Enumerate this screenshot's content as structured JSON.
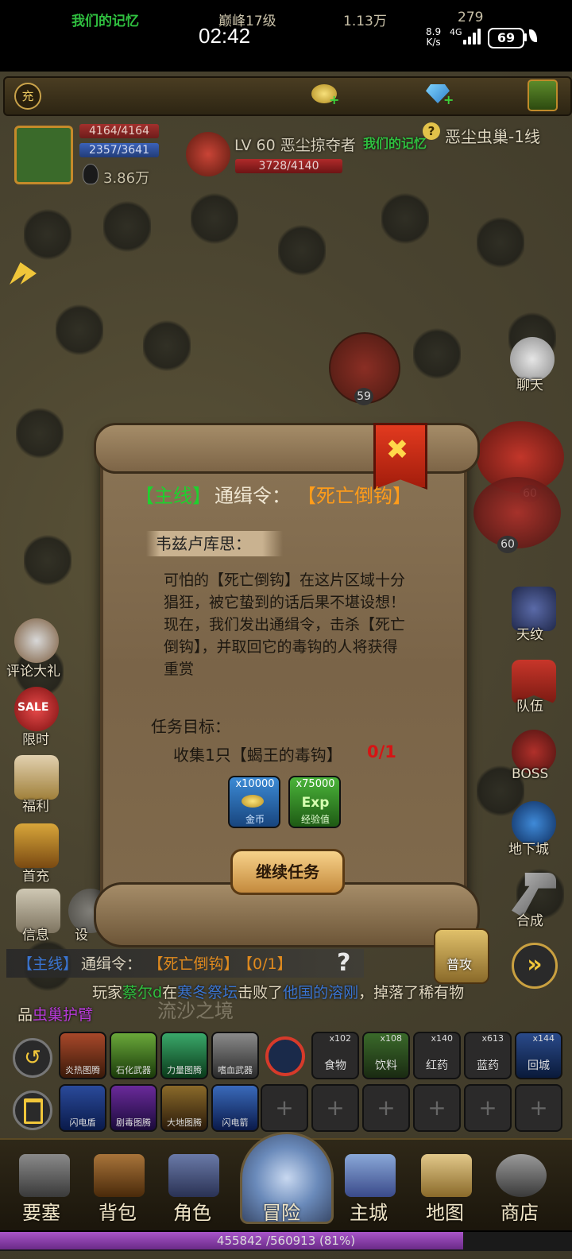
{
  "status_bar": {
    "time": "02:42",
    "net_speed_value": "8.9",
    "net_speed_unit": "K/s",
    "network": "4G",
    "battery": "69"
  },
  "top_bar": {
    "guild_badge": "充",
    "guild_name": "我们的记忆",
    "peak_level": "巅峰17级",
    "gold": "1.13万",
    "diamonds": "279",
    "gold_color": "#e6c84a",
    "guild_color": "#2fbf3f"
  },
  "player": {
    "hp": "4164/4164",
    "mp": "2357/3641",
    "power": "3.86万"
  },
  "target": {
    "name": "LV 60 恶尘掠夺者",
    "guild": "我们的记忆",
    "hp": "3728/4140",
    "map_name": "恶尘虫巢-1线"
  },
  "monsters": {
    "level_59": "59",
    "level_60a": "60",
    "level_60b": "60"
  },
  "dialog": {
    "tag": "【主线】",
    "title_prefix": "通缉令：",
    "title_target": "【死亡倒钩】",
    "speaker": "韦兹卢库思：",
    "body": "可怕的【死亡倒钩】在这片区域十分猖狂，被它蛰到的话后果不堪设想！现在，我们发出通缉令，击杀【死亡倒钩】，并取回它的毒钩的人将获得重赏",
    "objective_label": "任务目标：",
    "objective": "收集1只【蝎王的毒钩】",
    "progress": "0/1",
    "rewards": [
      {
        "count": "x10000",
        "label": "金币",
        "icon": "gold-coin-icon"
      },
      {
        "count": "x75000",
        "label": "经验值",
        "icon_text": "Exp",
        "icon": "exp-icon"
      }
    ],
    "continue_label": "继续任务",
    "close_icon": "✖"
  },
  "side_left": {
    "review_gift": "评论大礼",
    "limited": "限时",
    "sale_badge": "SALE",
    "welfare": "福利",
    "first_charge": "首充",
    "info": "信息",
    "settings": "设"
  },
  "side_right": {
    "chat": "聊天",
    "tianshi": "天纹",
    "team": "队伍",
    "boss": "BOSS",
    "dungeon": "地下城",
    "craft": "合成"
  },
  "quest_tracker": {
    "tag": "【主线】",
    "text": "通缉令：",
    "target": "【死亡倒钩】",
    "progress": "【0/1】",
    "help": "?"
  },
  "broadcast": {
    "line1_prefix": "玩家",
    "player": "蔡尔d",
    "line1_mid": "在",
    "location": "寒冬祭坛",
    "line1_action": "击败了",
    "boss": "他国的溶刚",
    "line1_end": "，掉落了稀有物",
    "line2_prefix": "品",
    "item": "虫巢护臂",
    "zone_overlay": "流沙之境"
  },
  "attack_button": "普攻",
  "skills_row1": [
    {
      "label": "炎热图腾"
    },
    {
      "label": "石化武器"
    },
    {
      "label": "力量图腾"
    },
    {
      "label": "嗜血武器"
    }
  ],
  "consumables": [
    {
      "count": "x102",
      "label": "食物"
    },
    {
      "count": "x108",
      "label": "饮料"
    },
    {
      "count": "x140",
      "label": "红药"
    },
    {
      "count": "x613",
      "label": "蓝药"
    },
    {
      "count": "x144",
      "label": "回城"
    }
  ],
  "skills_row2": [
    {
      "label": "闪电盾"
    },
    {
      "label": "剧毒图腾"
    },
    {
      "label": "大地图腾"
    },
    {
      "label": "闪电箭"
    }
  ],
  "empty_slot_symbol": "+",
  "nav": [
    {
      "label": "要塞"
    },
    {
      "label": "背包"
    },
    {
      "label": "角色"
    },
    {
      "label": "冒险"
    },
    {
      "label": "主城"
    },
    {
      "label": "地图"
    },
    {
      "label": "商店"
    }
  ],
  "experience": {
    "text": "455842 /560913 (81%)",
    "percent": 81
  }
}
